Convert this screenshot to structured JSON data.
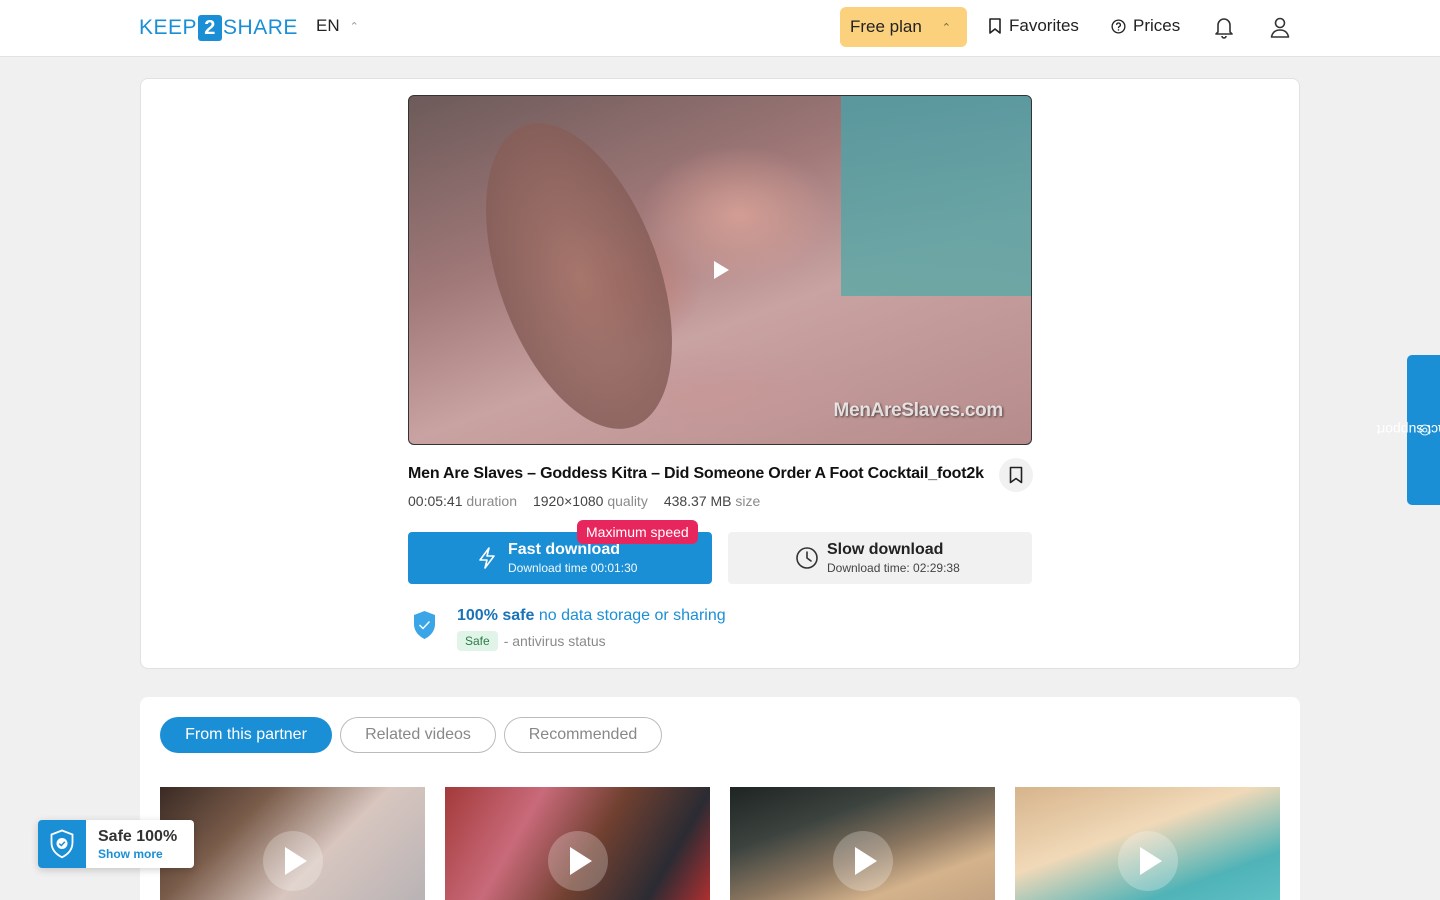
{
  "header": {
    "logo_left": "KEEP",
    "logo_num": "2",
    "logo_right": "SHARE",
    "language": "EN",
    "plan_label": "Free plan",
    "favorites_label": "Favorites",
    "prices_label": "Prices"
  },
  "video": {
    "watermark": "MenAreSlaves.com",
    "title": "Men Are Slaves – Goddess Kitra – Did Someone Order A Foot Cocktail_foot2k",
    "duration_value": "00:05:41",
    "duration_label": "duration",
    "quality_value": "1920×1080",
    "quality_label": "quality",
    "size_value": "438.37 MB",
    "size_label": "size"
  },
  "download": {
    "badge": "Maximum speed",
    "fast_title": "Fast download",
    "fast_time": "Download time 00:01:30",
    "slow_title": "Slow download",
    "slow_time": "Download time: 02:29:38"
  },
  "safety": {
    "bold": "100% safe",
    "rest": "no data storage or sharing",
    "av_badge": "Safe",
    "av_label": "- antivirus status"
  },
  "support_label": "contact support",
  "tabs": [
    "From this partner",
    "Related videos",
    "Recommended"
  ],
  "safe_widget": {
    "title": "Safe 100%",
    "link": "Show more"
  },
  "colors": {
    "brand_blue": "#1b8fd6",
    "plan_yellow": "#fcd17e",
    "badge_pink": "#e8265e"
  }
}
